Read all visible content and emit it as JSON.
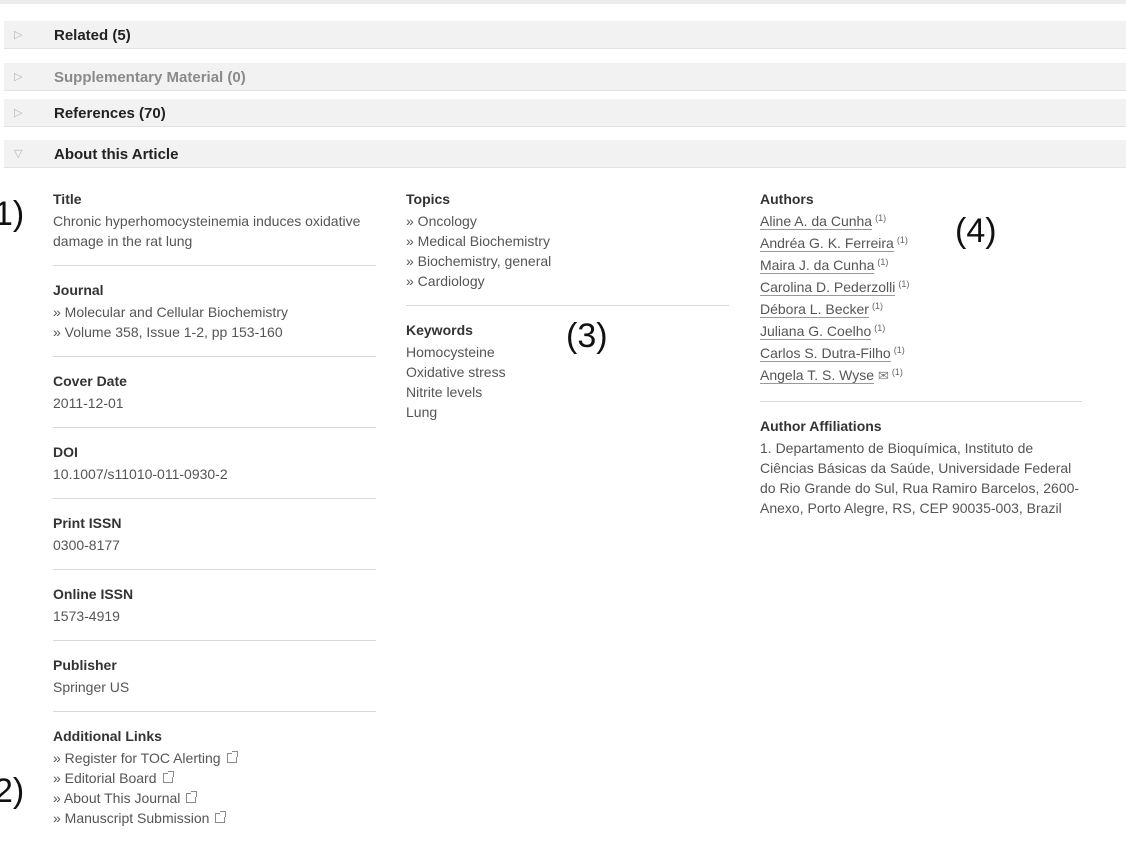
{
  "accordion": [
    {
      "label": "Related (5)",
      "dim": false,
      "expanded": false
    },
    {
      "label": "Supplementary Material (0)",
      "dim": true,
      "expanded": false
    },
    {
      "label": "References (70)",
      "dim": false,
      "expanded": false
    },
    {
      "label": "About this Article",
      "dim": false,
      "expanded": true
    }
  ],
  "left": {
    "title_label": "Title",
    "title_value": "Chronic hyperhomocysteinemia induces oxidative damage in the rat lung",
    "journal_label": "Journal",
    "journal_lines": [
      "» Molecular and Cellular Biochemistry",
      "» Volume 358, Issue 1-2, pp 153-160"
    ],
    "cover_date_label": "Cover Date",
    "cover_date": "2011-12-01",
    "doi_label": "DOI",
    "doi": "10.1007/s11010-011-0930-2",
    "print_issn_label": "Print ISSN",
    "print_issn": "0300-8177",
    "online_issn_label": "Online ISSN",
    "online_issn": "1573-4919",
    "publisher_label": "Publisher",
    "publisher": "Springer US",
    "additional_links_label": "Additional Links",
    "additional_links": [
      "» Register for TOC Alerting",
      "» Editorial Board",
      "» About This Journal",
      "» Manuscript Submission"
    ]
  },
  "middle": {
    "topics_label": "Topics",
    "topics": [
      "» Oncology",
      "» Medical Biochemistry",
      "» Biochemistry, general",
      "» Cardiology"
    ],
    "keywords_label": "Keywords",
    "keywords": [
      "Homocysteine",
      "Oxidative stress",
      "Nitrite levels",
      "Lung"
    ]
  },
  "right": {
    "authors_label": "Authors",
    "authors": [
      {
        "name": "Aline A. da Cunha",
        "sup": "(1)",
        "mail": false
      },
      {
        "name": "Andréa G. K. Ferreira",
        "sup": "(1)",
        "mail": false
      },
      {
        "name": "Maira J. da Cunha",
        "sup": "(1)",
        "mail": false
      },
      {
        "name": "Carolina D. Pederzolli",
        "sup": "(1)",
        "mail": false
      },
      {
        "name": "Débora L. Becker",
        "sup": "(1)",
        "mail": false
      },
      {
        "name": "Juliana G. Coelho",
        "sup": "(1)",
        "mail": false
      },
      {
        "name": "Carlos S. Dutra-Filho",
        "sup": "(1)",
        "mail": false
      },
      {
        "name": "Angela T. S. Wyse",
        "sup": "(1)",
        "mail": true
      }
    ],
    "affiliations_label": "Author Affiliations",
    "affiliations": "1. Departamento de Bioquímica, Instituto de Ciências Básicas da Saúde, Universidade Federal do Rio Grande do Sul, Rua Ramiro Barcelos, 2600-Anexo, Porto Alegre, RS, CEP 90035-003, Brazil"
  },
  "annotations": {
    "a1": "1)",
    "a2": "2)",
    "a3": "(3)",
    "a4": "(4)"
  },
  "icons": {
    "collapsed": "triangle-right-icon",
    "expanded": "triangle-down-icon",
    "external": "external-link-icon",
    "mail": "envelope-icon"
  }
}
